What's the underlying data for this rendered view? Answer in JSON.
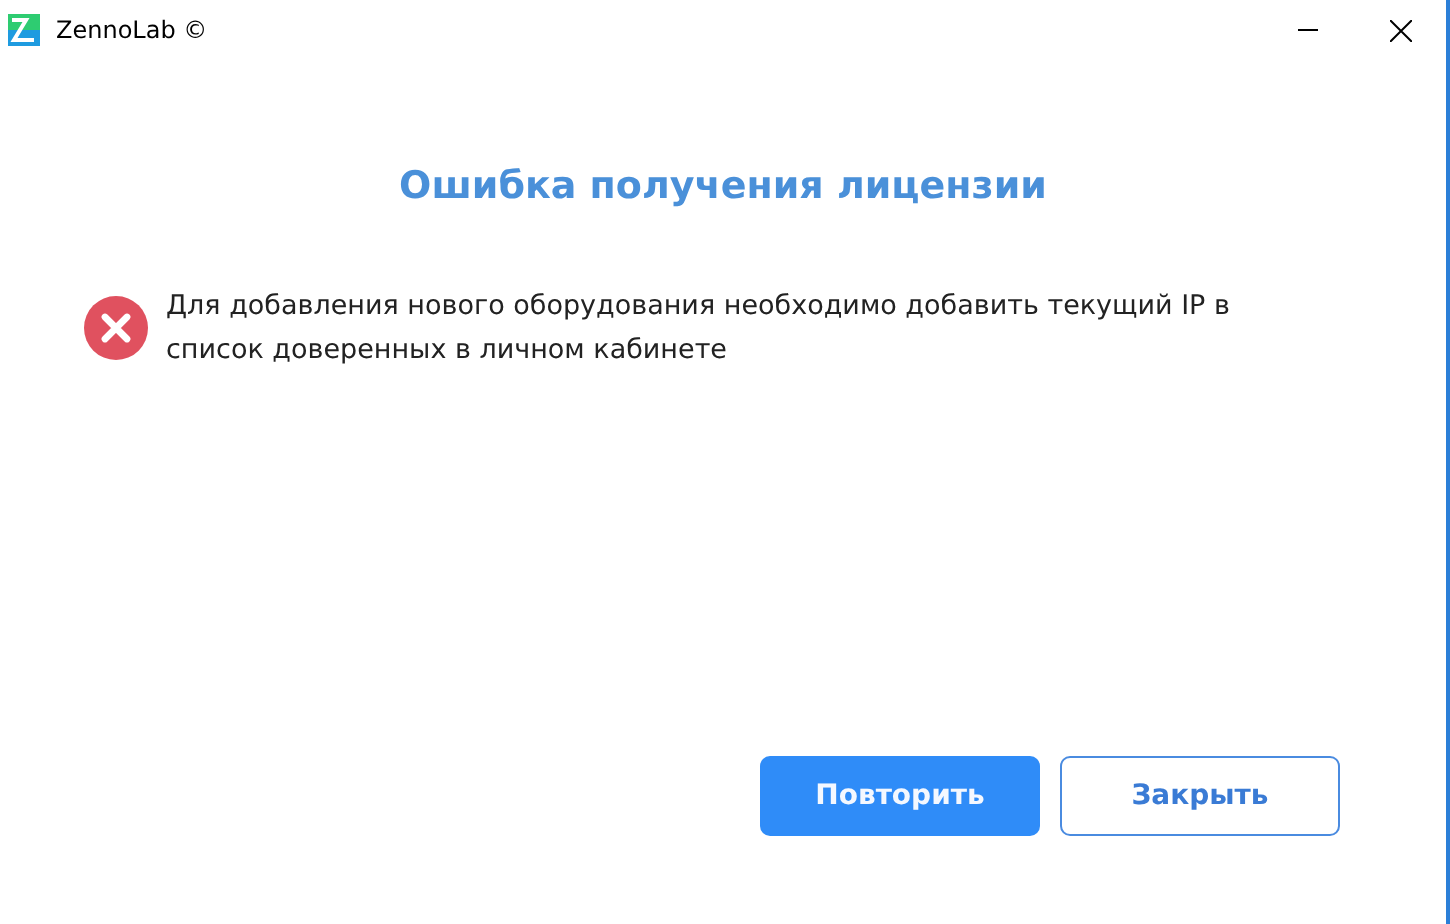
{
  "window": {
    "title": "ZennoLab ©"
  },
  "heading": "Ошибка получения лицензии",
  "message": {
    "kind": "error",
    "text": "Для добавления нового оборудования необходимо добавить текущий IP в список доверенных в личном кабинете"
  },
  "buttons": [
    {
      "label": "Повторить",
      "kind": "primary"
    },
    {
      "label": "Закрыть",
      "kind": "secondary"
    }
  ]
}
